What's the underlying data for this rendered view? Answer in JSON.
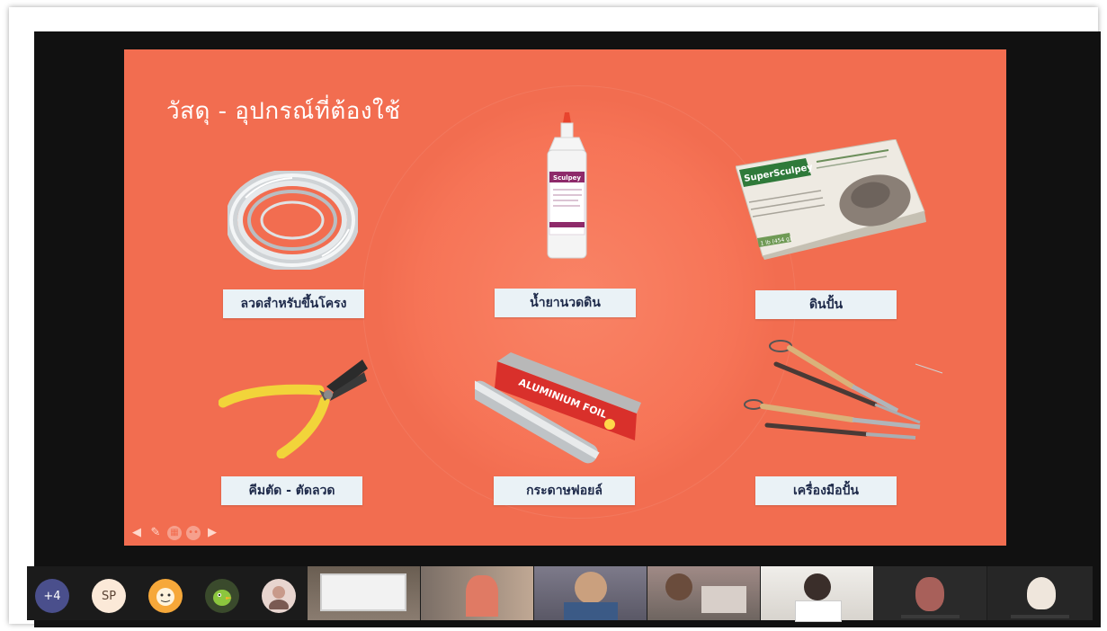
{
  "slide": {
    "title": "วัสดุ - อุปกรณ์ที่ต้องใช้",
    "items": [
      {
        "label": "ลวดสำหรับขึ้นโครง",
        "icon": "wire-coil-icon"
      },
      {
        "label": "น้ำยานวดดิน",
        "icon": "clay-softener-bottle-icon",
        "bottle_brand": "Sculpey"
      },
      {
        "label": "ดินปั้น",
        "icon": "super-sculpey-box-icon",
        "box_brand": "SuperSculpey",
        "box_weight": "1 lb (454 g)"
      },
      {
        "label": "คีมตัด - ตัดลวด",
        "icon": "wire-cutter-pliers-icon"
      },
      {
        "label": "กระดาษฟอยล์",
        "icon": "aluminium-foil-icon",
        "foil_text": "ALUMINIUM FOIL"
      },
      {
        "label": "เครื่องมือปั้น",
        "icon": "sculpting-tools-icon"
      }
    ]
  },
  "participants": {
    "overflow_badge": "+4",
    "initials_avatar": "SP"
  },
  "colors": {
    "slide_bg": "#f26d50",
    "label_bg": "#eaf2f6",
    "label_text": "#1e2a4a",
    "overflow_badge_bg": "#4a4f8c"
  }
}
